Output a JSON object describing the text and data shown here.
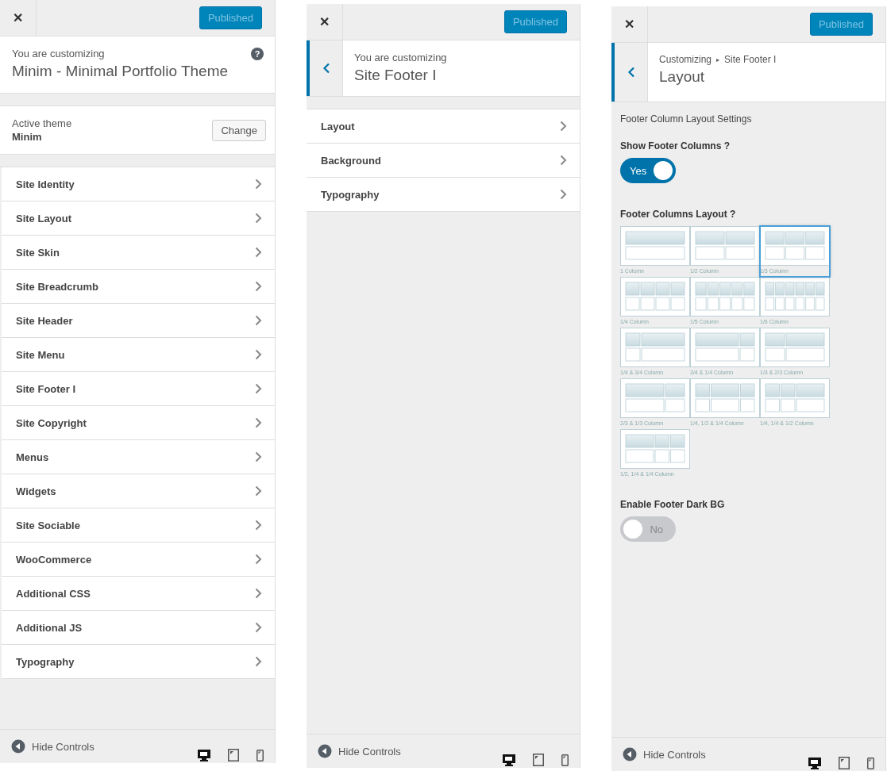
{
  "panels": [
    {
      "kind": "main",
      "top": {
        "close": "✕",
        "publish": "Published"
      },
      "header": {
        "caption": "You are customizing",
        "title": "Minim - Minimal Portfolio Theme",
        "help": "?"
      },
      "theme": {
        "caption": "Active theme",
        "name": "Minim",
        "button": "Change"
      },
      "items": [
        "Site Identity",
        "Site Layout",
        "Site Skin",
        "Site Breadcrumb",
        "Site Header",
        "Site Menu",
        "Site Footer I",
        "Site Copyright",
        "Menus",
        "Widgets",
        "Site Sociable",
        "WooCommerce",
        "Additional CSS",
        "Additional JS",
        "Typography"
      ],
      "footer": {
        "label": "Hide Controls",
        "devices": [
          {
            "kind": "desktop",
            "selected": true
          },
          {
            "kind": "tablet",
            "selected": false
          },
          {
            "kind": "mobile",
            "selected": false
          }
        ]
      }
    },
    {
      "kind": "section",
      "top": {
        "close": "✕",
        "publish": "Published"
      },
      "header": {
        "caption": "You are customizing",
        "title": "Site Footer I"
      },
      "items": [
        "Layout",
        "Background",
        "Typography"
      ],
      "footer": {
        "label": "Hide Controls",
        "devices": [
          {
            "kind": "desktop",
            "selected": true
          },
          {
            "kind": "tablet",
            "selected": false
          },
          {
            "kind": "mobile",
            "selected": false
          }
        ]
      }
    },
    {
      "kind": "settings",
      "top": {
        "close": "✕",
        "publish": "Published"
      },
      "header": {
        "crumb": "Customizing",
        "separator": "▸",
        "crumb_current": "Site Footer I",
        "title": "Layout"
      },
      "heading": "Footer Column Layout Settings",
      "show_columns": {
        "label": "Show Footer Columns ?",
        "on": true,
        "text": "Yes"
      },
      "layout_label": "Footer Columns Layout ?",
      "layouts": [
        {
          "kind": "full",
          "label": "1 Column",
          "selected": false
        },
        {
          "kind": "halves",
          "label": "1/2 Column",
          "selected": false
        },
        {
          "kind": "thirds",
          "label": "1/3 Column",
          "selected": true
        },
        {
          "kind": "quarters",
          "label": "1/4 Column",
          "selected": false
        },
        {
          "kind": "fifths",
          "label": "1/5 Column",
          "selected": false
        },
        {
          "kind": "sixths",
          "label": "1/6 Column",
          "selected": false
        },
        {
          "kind": "quarter-wide",
          "label": "1/4 & 3/4 Column",
          "selected": false
        },
        {
          "kind": "wide-quarter",
          "label": "3/4 & 1/4 Column",
          "selected": false
        },
        {
          "kind": "third-wide",
          "label": "1/3 & 2/3 Column",
          "selected": false
        },
        {
          "kind": "wide-third",
          "label": "2/3 & 1/3 Column",
          "selected": false
        },
        {
          "kind": "quarter-half-quarter",
          "label": "1/4, 1/2 & 1/4 Column",
          "selected": false
        },
        {
          "kind": "quarter-quarter-half",
          "label": "1/4, 1/4 & 1/2 Column",
          "selected": false
        },
        {
          "kind": "half-quarter-quarter",
          "label": "1/2, 1/4 & 1/4 Column",
          "selected": false
        }
      ],
      "dark_bg": {
        "label": "Enable Footer Dark BG",
        "on": false,
        "text": "No"
      },
      "footer": {
        "label": "Hide Controls",
        "devices": [
          {
            "kind": "desktop",
            "selected": true
          },
          {
            "kind": "tablet",
            "selected": false
          },
          {
            "kind": "mobile",
            "selected": false
          }
        ]
      }
    }
  ]
}
